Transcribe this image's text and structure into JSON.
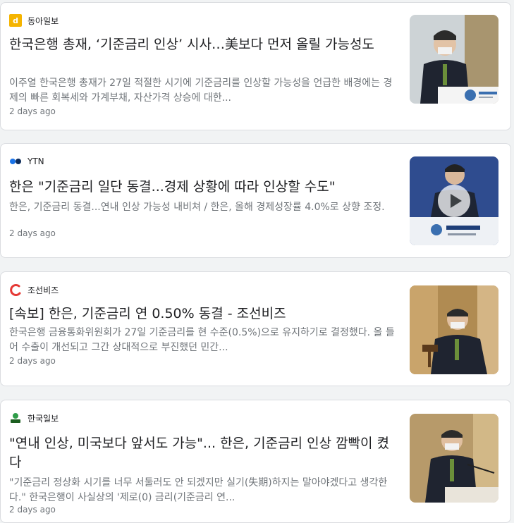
{
  "articles": [
    {
      "source": "동아일보",
      "logo_color": "#f5b400",
      "title": "한국은행 총재, ‘기준금리 인상’ 시사…美보다 먼저 올릴 가능성도",
      "snippet": "이주열 한국은행 총재가 27일 적절한 시기에 기준금리를 인상할 가능성을 언급한 배경에는 경제의 빠른 회복세와 가계부채, 자산가격 상승에 대한...",
      "time": "2 days ago",
      "thumb_icon": "press-conference-photo"
    },
    {
      "source": "YTN",
      "logo_color": "#1a73e8",
      "title": "한은 \"기준금리 일단 동결...경제 상황에 따라 인상할 수도\"",
      "snippet": "한은, 기준금리 동결...연내 인상 가능성 내비쳐 / 한은, 올해 경제성장률 4.0%로 상향 조정.",
      "time": "2 days ago",
      "thumb_icon": "video-thumbnail",
      "play_icon": "play-icon"
    },
    {
      "source": "조선비즈",
      "logo_color": "#e53935",
      "title": "[속보] 한은, 기준금리 연 0.50% 동결 - 조선비즈",
      "snippet": "한국은행 금융통화위원회가 27일 기준금리를 현 수준(0.5%)으로 유지하기로 결정했다. 올 들어 수출이 개선되고 그간 상대적으로 부진했던 민간...",
      "time": "2 days ago",
      "thumb_icon": "gavel-photo"
    },
    {
      "source": "한국일보",
      "logo_color": "#2e9c48",
      "title": "\"연내 인상, 미국보다 앞서도 가능\"... 한은, 기준금리 인상 깜빡이 켰다",
      "snippet": "\"기준금리 정상화 시기를 너무 서둘러도 안 되겠지만 실기(失期)하지는 말아야겠다고 생각한다.\" 한국은행이 사실상의 '제로(0) 금리(기준금리 연...",
      "time": "2 days ago",
      "thumb_icon": "speaker-photo"
    }
  ]
}
